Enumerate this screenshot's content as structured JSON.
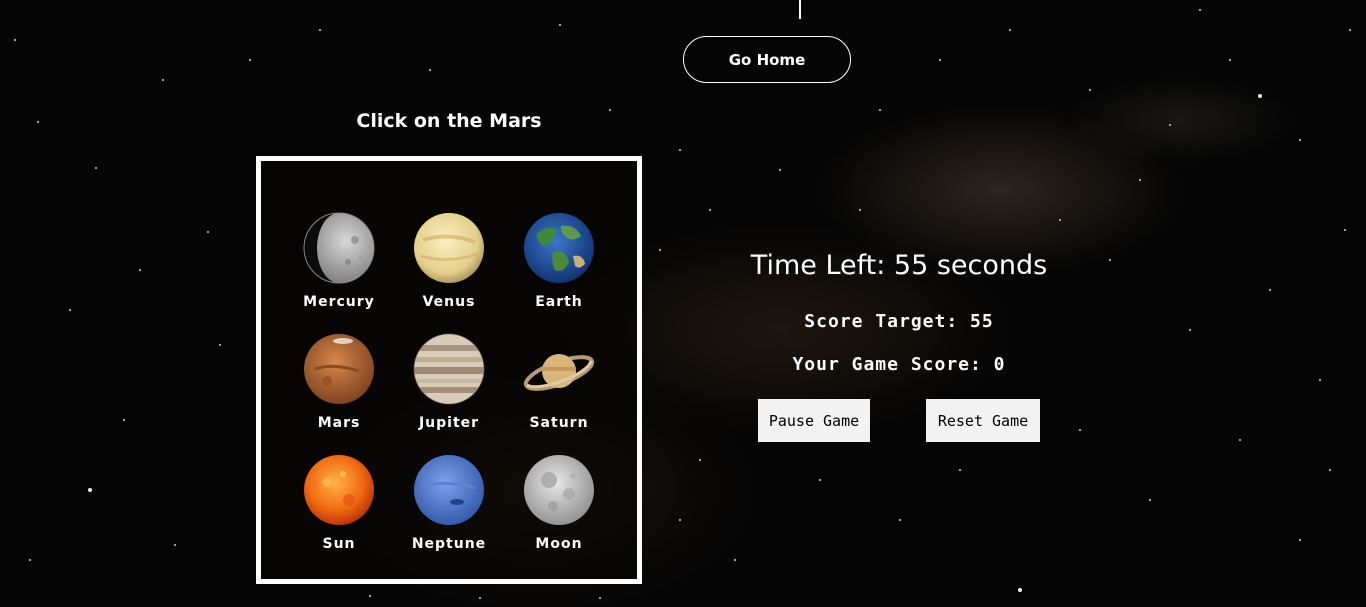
{
  "nav": {
    "go_home": "Go Home"
  },
  "game": {
    "instruction": "Click on the Mars",
    "time_left": "Time Left: 55 seconds",
    "score_target": "Score Target: 55",
    "score": "Your Game Score: 0",
    "pause_label": "Pause Game",
    "reset_label": "Reset Game"
  },
  "planets": [
    {
      "name": "Mercury",
      "icon": "mercury-icon"
    },
    {
      "name": "Venus",
      "icon": "venus-icon"
    },
    {
      "name": "Earth",
      "icon": "earth-icon"
    },
    {
      "name": "Mars",
      "icon": "mars-icon"
    },
    {
      "name": "Jupiter",
      "icon": "jupiter-icon"
    },
    {
      "name": "Saturn",
      "icon": "saturn-icon"
    },
    {
      "name": "Sun",
      "icon": "sun-icon"
    },
    {
      "name": "Neptune",
      "icon": "neptune-icon"
    },
    {
      "name": "Moon",
      "icon": "moon-icon"
    }
  ]
}
